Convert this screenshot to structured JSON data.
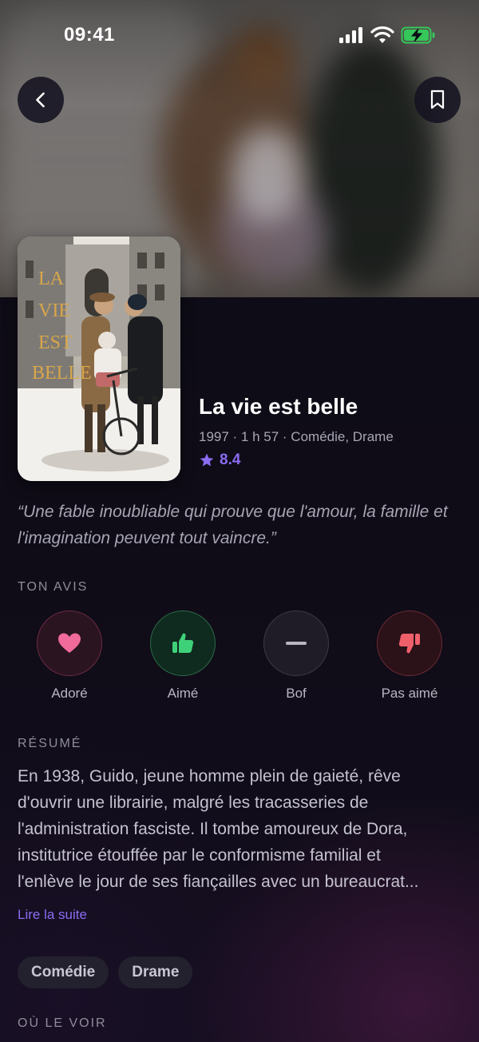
{
  "status_bar": {
    "time": "09:41"
  },
  "movie": {
    "title": "La vie est belle",
    "meta": "1997 · 1 h 57 · Comédie, Drame",
    "rating": "8.4",
    "poster_title_lines": [
      "La",
      "Vie",
      "Est",
      "Belle"
    ],
    "quote": "“Une fable inoubliable qui prouve que l'amour, la famille et l'imagination peuvent tout vaincre.”"
  },
  "sections": {
    "opinion": "TON AVIS",
    "summary": "RÉSUMÉ",
    "where": "OÙ LE VOIR"
  },
  "reactions": [
    {
      "label": "Adoré",
      "icon": "heart-icon",
      "color": "#f06a9a"
    },
    {
      "label": "Aimé",
      "icon": "thumbs-up-icon",
      "color": "#3fd17a"
    },
    {
      "label": "Bof",
      "icon": "minus-icon",
      "color": "#b9b6c2"
    },
    {
      "label": "Pas aimé",
      "icon": "thumbs-down-icon",
      "color": "#f0606a"
    }
  ],
  "summary": {
    "lines": [
      "En 1938, Guido, jeune homme plein de gaieté, rêve",
      "d'ouvrir une librairie, malgré les tracasseries de",
      "l'administration fasciste. Il tombe amoureux de Dora,",
      "institutrice étouffée par le conformisme familial et",
      "l'enlève le jour de ses fiançailles avec un bureaucrat..."
    ],
    "read_more": "Lire la suite"
  },
  "genres": [
    "Comédie",
    "Drame"
  ],
  "colors": {
    "accent": "#8b6cf1",
    "background": "#0e0c16"
  }
}
